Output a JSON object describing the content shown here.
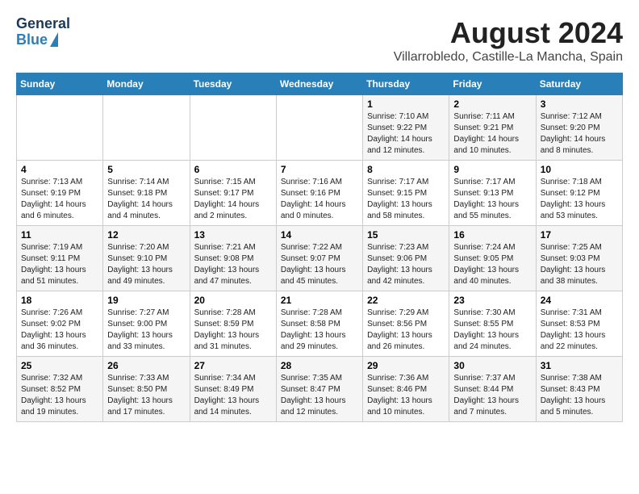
{
  "logo": {
    "line1": "General",
    "line2": "Blue"
  },
  "title": "August 2024",
  "subtitle": "Villarrobledo, Castille-La Mancha, Spain",
  "headers": [
    "Sunday",
    "Monday",
    "Tuesday",
    "Wednesday",
    "Thursday",
    "Friday",
    "Saturday"
  ],
  "weeks": [
    [
      {
        "num": "",
        "detail": ""
      },
      {
        "num": "",
        "detail": ""
      },
      {
        "num": "",
        "detail": ""
      },
      {
        "num": "",
        "detail": ""
      },
      {
        "num": "1",
        "detail": "Sunrise: 7:10 AM\nSunset: 9:22 PM\nDaylight: 14 hours\nand 12 minutes."
      },
      {
        "num": "2",
        "detail": "Sunrise: 7:11 AM\nSunset: 9:21 PM\nDaylight: 14 hours\nand 10 minutes."
      },
      {
        "num": "3",
        "detail": "Sunrise: 7:12 AM\nSunset: 9:20 PM\nDaylight: 14 hours\nand 8 minutes."
      }
    ],
    [
      {
        "num": "4",
        "detail": "Sunrise: 7:13 AM\nSunset: 9:19 PM\nDaylight: 14 hours\nand 6 minutes."
      },
      {
        "num": "5",
        "detail": "Sunrise: 7:14 AM\nSunset: 9:18 PM\nDaylight: 14 hours\nand 4 minutes."
      },
      {
        "num": "6",
        "detail": "Sunrise: 7:15 AM\nSunset: 9:17 PM\nDaylight: 14 hours\nand 2 minutes."
      },
      {
        "num": "7",
        "detail": "Sunrise: 7:16 AM\nSunset: 9:16 PM\nDaylight: 14 hours\nand 0 minutes."
      },
      {
        "num": "8",
        "detail": "Sunrise: 7:17 AM\nSunset: 9:15 PM\nDaylight: 13 hours\nand 58 minutes."
      },
      {
        "num": "9",
        "detail": "Sunrise: 7:17 AM\nSunset: 9:13 PM\nDaylight: 13 hours\nand 55 minutes."
      },
      {
        "num": "10",
        "detail": "Sunrise: 7:18 AM\nSunset: 9:12 PM\nDaylight: 13 hours\nand 53 minutes."
      }
    ],
    [
      {
        "num": "11",
        "detail": "Sunrise: 7:19 AM\nSunset: 9:11 PM\nDaylight: 13 hours\nand 51 minutes."
      },
      {
        "num": "12",
        "detail": "Sunrise: 7:20 AM\nSunset: 9:10 PM\nDaylight: 13 hours\nand 49 minutes."
      },
      {
        "num": "13",
        "detail": "Sunrise: 7:21 AM\nSunset: 9:08 PM\nDaylight: 13 hours\nand 47 minutes."
      },
      {
        "num": "14",
        "detail": "Sunrise: 7:22 AM\nSunset: 9:07 PM\nDaylight: 13 hours\nand 45 minutes."
      },
      {
        "num": "15",
        "detail": "Sunrise: 7:23 AM\nSunset: 9:06 PM\nDaylight: 13 hours\nand 42 minutes."
      },
      {
        "num": "16",
        "detail": "Sunrise: 7:24 AM\nSunset: 9:05 PM\nDaylight: 13 hours\nand 40 minutes."
      },
      {
        "num": "17",
        "detail": "Sunrise: 7:25 AM\nSunset: 9:03 PM\nDaylight: 13 hours\nand 38 minutes."
      }
    ],
    [
      {
        "num": "18",
        "detail": "Sunrise: 7:26 AM\nSunset: 9:02 PM\nDaylight: 13 hours\nand 36 minutes."
      },
      {
        "num": "19",
        "detail": "Sunrise: 7:27 AM\nSunset: 9:00 PM\nDaylight: 13 hours\nand 33 minutes."
      },
      {
        "num": "20",
        "detail": "Sunrise: 7:28 AM\nSunset: 8:59 PM\nDaylight: 13 hours\nand 31 minutes."
      },
      {
        "num": "21",
        "detail": "Sunrise: 7:28 AM\nSunset: 8:58 PM\nDaylight: 13 hours\nand 29 minutes."
      },
      {
        "num": "22",
        "detail": "Sunrise: 7:29 AM\nSunset: 8:56 PM\nDaylight: 13 hours\nand 26 minutes."
      },
      {
        "num": "23",
        "detail": "Sunrise: 7:30 AM\nSunset: 8:55 PM\nDaylight: 13 hours\nand 24 minutes."
      },
      {
        "num": "24",
        "detail": "Sunrise: 7:31 AM\nSunset: 8:53 PM\nDaylight: 13 hours\nand 22 minutes."
      }
    ],
    [
      {
        "num": "25",
        "detail": "Sunrise: 7:32 AM\nSunset: 8:52 PM\nDaylight: 13 hours\nand 19 minutes."
      },
      {
        "num": "26",
        "detail": "Sunrise: 7:33 AM\nSunset: 8:50 PM\nDaylight: 13 hours\nand 17 minutes."
      },
      {
        "num": "27",
        "detail": "Sunrise: 7:34 AM\nSunset: 8:49 PM\nDaylight: 13 hours\nand 14 minutes."
      },
      {
        "num": "28",
        "detail": "Sunrise: 7:35 AM\nSunset: 8:47 PM\nDaylight: 13 hours\nand 12 minutes."
      },
      {
        "num": "29",
        "detail": "Sunrise: 7:36 AM\nSunset: 8:46 PM\nDaylight: 13 hours\nand 10 minutes."
      },
      {
        "num": "30",
        "detail": "Sunrise: 7:37 AM\nSunset: 8:44 PM\nDaylight: 13 hours\nand 7 minutes."
      },
      {
        "num": "31",
        "detail": "Sunrise: 7:38 AM\nSunset: 8:43 PM\nDaylight: 13 hours\nand 5 minutes."
      }
    ]
  ]
}
